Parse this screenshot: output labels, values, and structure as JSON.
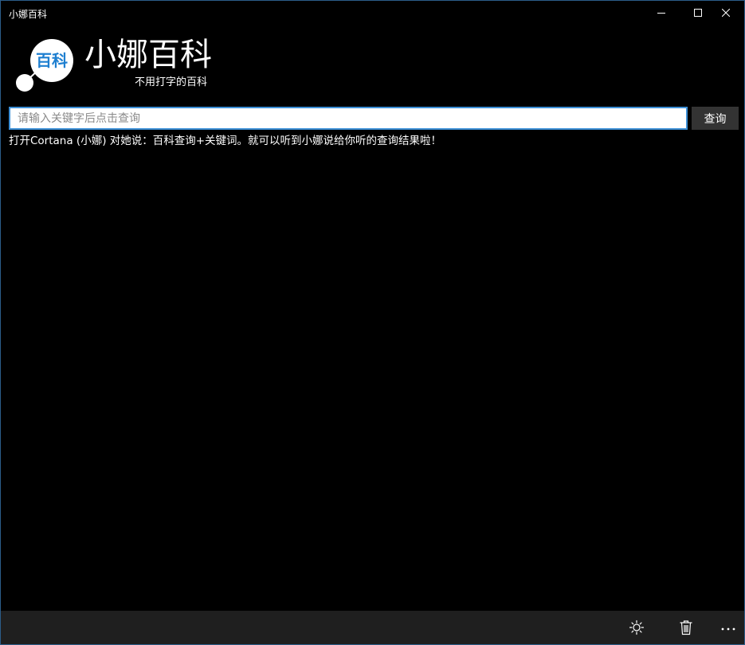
{
  "window": {
    "title": "小娜百科"
  },
  "header": {
    "logo_text": "百科",
    "app_name": "小娜百科",
    "subtitle": "不用打字的百科"
  },
  "search": {
    "placeholder": "请输入关键字后点击查询",
    "value": "",
    "button_label": "查询"
  },
  "hint": {
    "text": "打开Cortana (小娜) 对她说：百科查询+关键词。就可以听到小娜说给你听的查询结果啦！"
  },
  "appbar": {
    "icons": [
      "brightness-icon",
      "delete-icon",
      "more-icon"
    ]
  },
  "colors": {
    "background": "#000000",
    "accent": "#3c8fd6",
    "logo_text": "#1e7fd0",
    "appbar": "#1f1f1f",
    "button": "#333333"
  }
}
